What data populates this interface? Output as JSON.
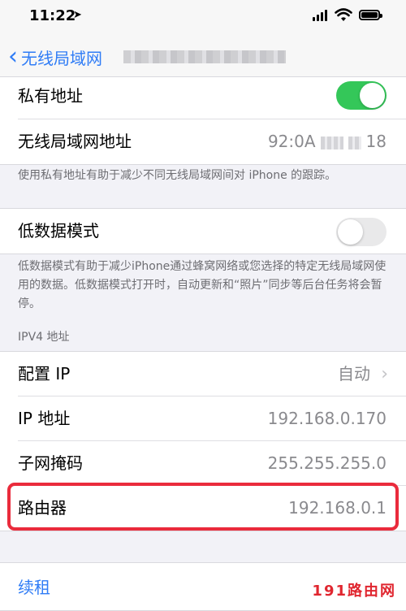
{
  "status_bar": {
    "time": "11:22",
    "location_icon": "location-arrow-icon",
    "signal_icon": "cellular-signal-icon",
    "wifi_icon": "wifi-icon",
    "battery_icon": "battery-full-icon"
  },
  "nav": {
    "back_label": "无线局域网",
    "back_icon": "chevron-left-icon"
  },
  "privacy": {
    "private_address_label": "私有地址",
    "private_address_enabled": true,
    "wlan_address_label": "无线局域网地址",
    "wlan_address_prefix": "92:0A",
    "wlan_address_suffix": "18",
    "footnote": "使用私有地址有助于减少不同无线局域网间对 iPhone 的跟踪。"
  },
  "low_data": {
    "label": "低数据模式",
    "enabled": false,
    "footnote": "低数据模式有助于减少iPhone通过蜂窝网络或您选择的特定无线局域网使用的数据。低数据模式打开时，自动更新和“照片”同步等后台任务将会暂停。"
  },
  "ipv4": {
    "header": "IPV4 地址",
    "configure_ip_label": "配置 IP",
    "configure_ip_value": "自动",
    "ip_label": "IP 地址",
    "ip_value": "192.168.0.170",
    "subnet_label": "子网掩码",
    "subnet_value": "255.255.255.0",
    "router_label": "路由器",
    "router_value": "192.168.0.1"
  },
  "renew_label": "续租",
  "watermark": "191路由网",
  "colors": {
    "accent": "#2f7cf6",
    "toggle_on": "#34c759",
    "highlight": "#ea2b3c",
    "watermark": "#e0262f"
  }
}
